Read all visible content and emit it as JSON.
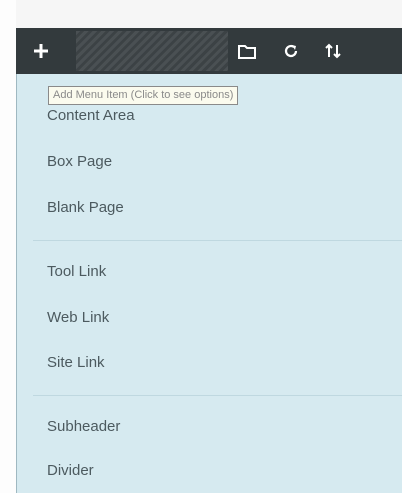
{
  "toolbar": {
    "add_icon": "plus-icon",
    "tooltip": "Add Menu Item (Click to see options)",
    "icons": [
      "folder-icon",
      "refresh-icon",
      "sort-icon"
    ]
  },
  "menu": {
    "groups": [
      {
        "items": [
          "Content Area",
          "Box Page",
          "Blank Page"
        ]
      },
      {
        "items": [
          "Tool Link",
          "Web Link",
          "Site Link"
        ]
      },
      {
        "items": [
          "Subheader",
          "Divider"
        ]
      }
    ]
  },
  "colors": {
    "toolbar_bg": "#333a3d",
    "menu_bg": "#d6eaf0",
    "menu_text": "#4c5a5f",
    "tooltip_bg": "#fbfbee"
  }
}
